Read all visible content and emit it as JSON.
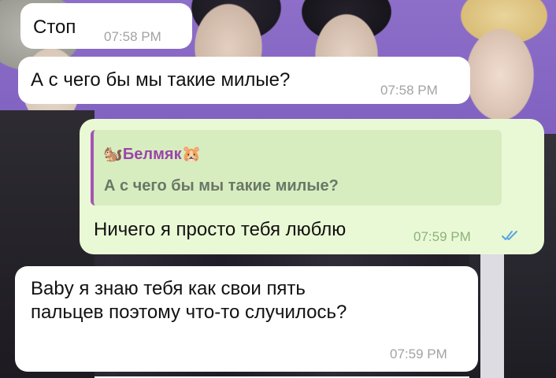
{
  "messages": [
    {
      "text": "Стоп",
      "time": "07:58 PM"
    },
    {
      "text": "А с чего бы мы такие милые?",
      "time": "07:58 PM"
    },
    {
      "reply": {
        "author": "🐿️Белмяк🐹",
        "quote": "А с чего бы мы такие милые?"
      },
      "text": "Ничего я просто тебя люблю",
      "time": "07:59 PM",
      "status_icon": "double-check-icon"
    },
    {
      "text": "Baby я знаю тебя как свои пять\nпальцев поэтому что-то случилось?",
      "time": "07:59 PM"
    }
  ],
  "colors": {
    "incoming_bubble": "#ffffff",
    "outgoing_bubble": "#eaf9d5",
    "reply_background": "#d7edc0",
    "reply_accent": "#a355b3",
    "read_ticks": "#5aa5e0"
  }
}
